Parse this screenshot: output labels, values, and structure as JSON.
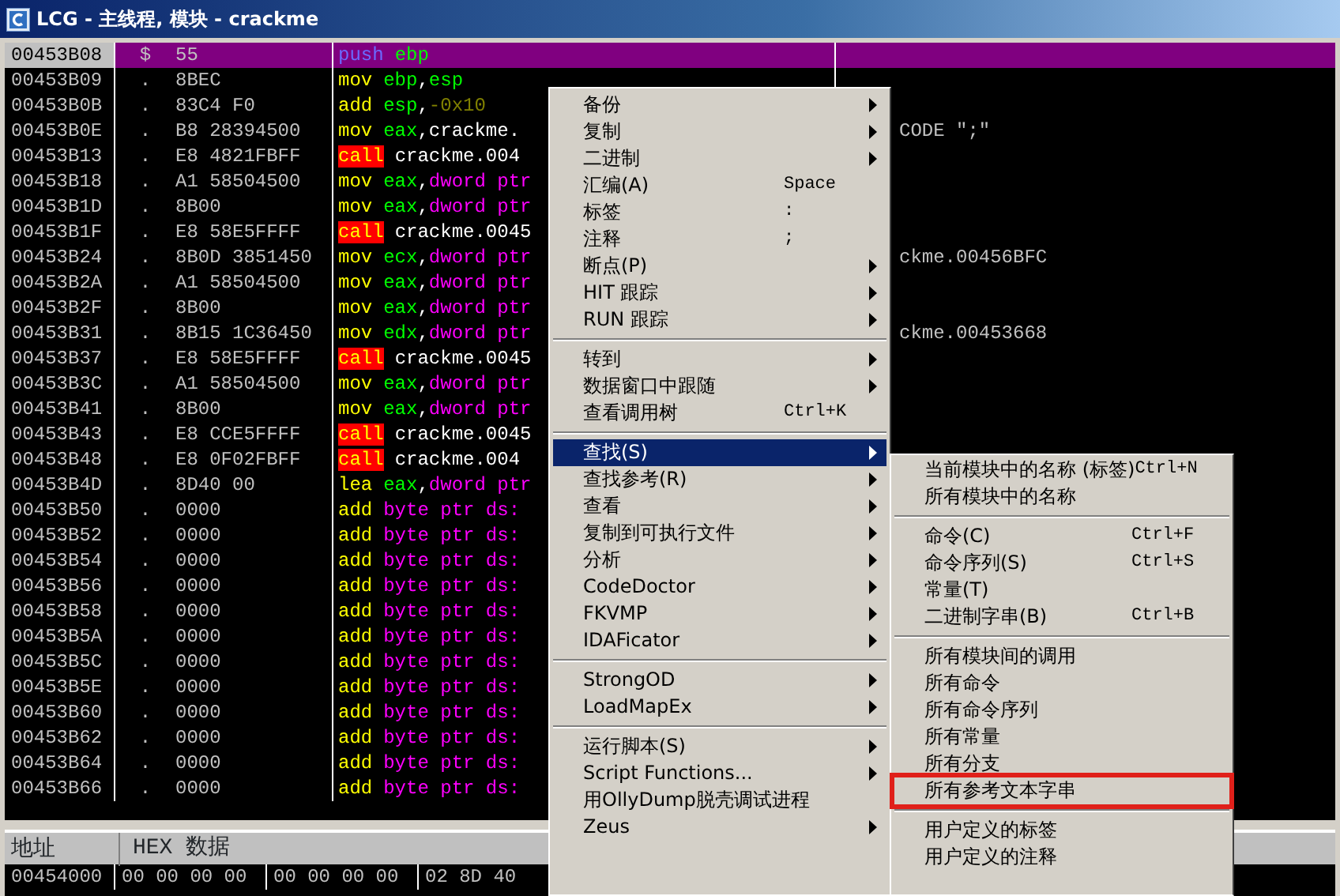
{
  "window": {
    "title": "LCG -  主线程, 模块 - crackme"
  },
  "disassembly": {
    "rows": [
      {
        "address": "00453B08",
        "mark": "$",
        "hex": "55",
        "selected": true,
        "asm": [
          {
            "text": "push",
            "kind": "push"
          },
          {
            "text": "ebp",
            "kind": "reg"
          }
        ]
      },
      {
        "address": "00453B09",
        "mark": ".",
        "hex": "8BEC",
        "selected": false,
        "asm": [
          {
            "text": "mov",
            "kind": "mn"
          },
          {
            "text": "ebp",
            "kind": "reg"
          },
          {
            "text": ",",
            "kind": "punct"
          },
          {
            "text": "esp",
            "kind": "reg"
          }
        ]
      },
      {
        "address": "00453B0B",
        "mark": ".",
        "hex": "83C4 F0",
        "selected": false,
        "asm": [
          {
            "text": "add",
            "kind": "mn"
          },
          {
            "text": "esp",
            "kind": "reg"
          },
          {
            "text": ",",
            "kind": "punct"
          },
          {
            "text": "-0x10",
            "kind": "imm"
          }
        ]
      },
      {
        "address": "00453B0E",
        "mark": ".",
        "hex": "B8 28394500",
        "selected": false,
        "asm": [
          {
            "text": "mov",
            "kind": "mn"
          },
          {
            "text": "eax",
            "kind": "reg"
          },
          {
            "text": ",",
            "kind": "punct"
          },
          {
            "text": "crackme.",
            "kind": "sym"
          }
        ],
        "comment": "CODE \";\""
      },
      {
        "address": "00453B13",
        "mark": ".",
        "hex": "E8 4821FBFF",
        "selected": false,
        "asm": [
          {
            "text": "call",
            "kind": "call"
          },
          {
            "text": "crackme.004",
            "kind": "sym"
          }
        ]
      },
      {
        "address": "00453B18",
        "mark": ".",
        "hex": "A1 58504500",
        "selected": false,
        "asm": [
          {
            "text": "mov",
            "kind": "mn"
          },
          {
            "text": "eax",
            "kind": "reg"
          },
          {
            "text": ",",
            "kind": "punct"
          },
          {
            "text": "dword ptr",
            "kind": "mem"
          }
        ]
      },
      {
        "address": "00453B1D",
        "mark": ".",
        "hex": "8B00",
        "selected": false,
        "asm": [
          {
            "text": "mov",
            "kind": "mn"
          },
          {
            "text": "eax",
            "kind": "reg"
          },
          {
            "text": ",",
            "kind": "punct"
          },
          {
            "text": "dword ptr",
            "kind": "mem"
          }
        ]
      },
      {
        "address": "00453B1F",
        "mark": ".",
        "hex": "E8 58E5FFFF",
        "selected": false,
        "asm": [
          {
            "text": "call",
            "kind": "call"
          },
          {
            "text": "crackme.0045",
            "kind": "sym"
          }
        ]
      },
      {
        "address": "00453B24",
        "mark": ".",
        "hex": "8B0D 3851450",
        "selected": false,
        "asm": [
          {
            "text": "mov",
            "kind": "mn"
          },
          {
            "text": "ecx",
            "kind": "reg"
          },
          {
            "text": ",",
            "kind": "punct"
          },
          {
            "text": "dword ptr",
            "kind": "mem"
          }
        ],
        "comment": "ckme.00456BFC"
      },
      {
        "address": "00453B2A",
        "mark": ".",
        "hex": "A1 58504500",
        "selected": false,
        "asm": [
          {
            "text": "mov",
            "kind": "mn"
          },
          {
            "text": "eax",
            "kind": "reg"
          },
          {
            "text": ",",
            "kind": "punct"
          },
          {
            "text": "dword ptr",
            "kind": "mem"
          }
        ]
      },
      {
        "address": "00453B2F",
        "mark": ".",
        "hex": "8B00",
        "selected": false,
        "asm": [
          {
            "text": "mov",
            "kind": "mn"
          },
          {
            "text": "eax",
            "kind": "reg"
          },
          {
            "text": ",",
            "kind": "punct"
          },
          {
            "text": "dword ptr",
            "kind": "mem"
          }
        ]
      },
      {
        "address": "00453B31",
        "mark": ".",
        "hex": "8B15 1C36450",
        "selected": false,
        "asm": [
          {
            "text": "mov",
            "kind": "mn"
          },
          {
            "text": "edx",
            "kind": "reg"
          },
          {
            "text": ",",
            "kind": "punct"
          },
          {
            "text": "dword ptr",
            "kind": "mem"
          }
        ],
        "comment": "ckme.00453668"
      },
      {
        "address": "00453B37",
        "mark": ".",
        "hex": "E8 58E5FFFF",
        "selected": false,
        "asm": [
          {
            "text": "call",
            "kind": "call"
          },
          {
            "text": "crackme.0045",
            "kind": "sym"
          }
        ]
      },
      {
        "address": "00453B3C",
        "mark": ".",
        "hex": "A1 58504500",
        "selected": false,
        "asm": [
          {
            "text": "mov",
            "kind": "mn"
          },
          {
            "text": "eax",
            "kind": "reg"
          },
          {
            "text": ",",
            "kind": "punct"
          },
          {
            "text": "dword ptr",
            "kind": "mem"
          }
        ]
      },
      {
        "address": "00453B41",
        "mark": ".",
        "hex": "8B00",
        "selected": false,
        "asm": [
          {
            "text": "mov",
            "kind": "mn"
          },
          {
            "text": "eax",
            "kind": "reg"
          },
          {
            "text": ",",
            "kind": "punct"
          },
          {
            "text": "dword ptr",
            "kind": "mem"
          }
        ]
      },
      {
        "address": "00453B43",
        "mark": ".",
        "hex": "E8 CCE5FFFF",
        "selected": false,
        "asm": [
          {
            "text": "call",
            "kind": "call"
          },
          {
            "text": "crackme.0045",
            "kind": "sym"
          }
        ]
      },
      {
        "address": "00453B48",
        "mark": ".",
        "hex": "E8 0F02FBFF",
        "selected": false,
        "asm": [
          {
            "text": "call",
            "kind": "call"
          },
          {
            "text": "crackme.004",
            "kind": "sym"
          }
        ]
      },
      {
        "address": "00453B4D",
        "mark": ".",
        "hex": "8D40 00",
        "selected": false,
        "asm": [
          {
            "text": "lea",
            "kind": "mn"
          },
          {
            "text": "eax",
            "kind": "reg"
          },
          {
            "text": ",",
            "kind": "punct"
          },
          {
            "text": "dword ptr",
            "kind": "mem"
          }
        ]
      },
      {
        "address": "00453B50",
        "mark": ".",
        "hex": "0000",
        "selected": false,
        "asm": [
          {
            "text": "add",
            "kind": "mn"
          },
          {
            "text": "byte ptr ds:",
            "kind": "mem"
          }
        ]
      },
      {
        "address": "00453B52",
        "mark": ".",
        "hex": "0000",
        "selected": false,
        "asm": [
          {
            "text": "add",
            "kind": "mn"
          },
          {
            "text": "byte ptr ds:",
            "kind": "mem"
          }
        ]
      },
      {
        "address": "00453B54",
        "mark": ".",
        "hex": "0000",
        "selected": false,
        "asm": [
          {
            "text": "add",
            "kind": "mn"
          },
          {
            "text": "byte ptr ds:",
            "kind": "mem"
          }
        ]
      },
      {
        "address": "00453B56",
        "mark": ".",
        "hex": "0000",
        "selected": false,
        "asm": [
          {
            "text": "add",
            "kind": "mn"
          },
          {
            "text": "byte ptr ds:",
            "kind": "mem"
          }
        ]
      },
      {
        "address": "00453B58",
        "mark": ".",
        "hex": "0000",
        "selected": false,
        "asm": [
          {
            "text": "add",
            "kind": "mn"
          },
          {
            "text": "byte ptr ds:",
            "kind": "mem"
          }
        ]
      },
      {
        "address": "00453B5A",
        "mark": ".",
        "hex": "0000",
        "selected": false,
        "asm": [
          {
            "text": "add",
            "kind": "mn"
          },
          {
            "text": "byte ptr ds:",
            "kind": "mem"
          }
        ]
      },
      {
        "address": "00453B5C",
        "mark": ".",
        "hex": "0000",
        "selected": false,
        "asm": [
          {
            "text": "add",
            "kind": "mn"
          },
          {
            "text": "byte ptr ds:",
            "kind": "mem"
          }
        ]
      },
      {
        "address": "00453B5E",
        "mark": ".",
        "hex": "0000",
        "selected": false,
        "asm": [
          {
            "text": "add",
            "kind": "mn"
          },
          {
            "text": "byte ptr ds:",
            "kind": "mem"
          }
        ]
      },
      {
        "address": "00453B60",
        "mark": ".",
        "hex": "0000",
        "selected": false,
        "asm": [
          {
            "text": "add",
            "kind": "mn"
          },
          {
            "text": "byte ptr ds:",
            "kind": "mem"
          }
        ]
      },
      {
        "address": "00453B62",
        "mark": ".",
        "hex": "0000",
        "selected": false,
        "asm": [
          {
            "text": "add",
            "kind": "mn"
          },
          {
            "text": "byte ptr ds:",
            "kind": "mem"
          }
        ]
      },
      {
        "address": "00453B64",
        "mark": ".",
        "hex": "0000",
        "selected": false,
        "asm": [
          {
            "text": "add",
            "kind": "mn"
          },
          {
            "text": "byte ptr ds:",
            "kind": "mem"
          }
        ]
      },
      {
        "address": "00453B66",
        "mark": ".",
        "hex": "0000",
        "selected": false,
        "asm": [
          {
            "text": "add",
            "kind": "mn"
          },
          {
            "text": "byte ptr ds:",
            "kind": "mem"
          }
        ]
      }
    ]
  },
  "dump": {
    "columns": [
      "地址",
      "HEX 数据"
    ],
    "rows": [
      {
        "address": "00454000",
        "groups": [
          "00 00 00 00",
          "00 00 00 00",
          "02 8D 40"
        ]
      }
    ]
  },
  "context_menu": {
    "items": [
      {
        "kind": "item",
        "label": "备份",
        "submenu": true,
        "selected": false
      },
      {
        "kind": "item",
        "label": "复制",
        "submenu": true,
        "selected": false
      },
      {
        "kind": "item",
        "label": "二进制",
        "submenu": true,
        "selected": false
      },
      {
        "kind": "item",
        "label": "汇编(A)",
        "shortcut": "Space",
        "submenu": false,
        "selected": false
      },
      {
        "kind": "item",
        "label": "标签",
        "shortcut": ":",
        "submenu": false,
        "selected": false
      },
      {
        "kind": "item",
        "label": "注释",
        "shortcut": ";",
        "submenu": false,
        "selected": false
      },
      {
        "kind": "item",
        "label": "断点(P)",
        "submenu": true,
        "selected": false
      },
      {
        "kind": "item",
        "label": "HIT 跟踪",
        "submenu": true,
        "selected": false
      },
      {
        "kind": "item",
        "label": "RUN 跟踪",
        "submenu": true,
        "selected": false
      },
      {
        "kind": "separator"
      },
      {
        "kind": "item",
        "label": "转到",
        "submenu": true,
        "selected": false
      },
      {
        "kind": "item",
        "label": "数据窗口中跟随",
        "submenu": true,
        "selected": false
      },
      {
        "kind": "item",
        "label": "查看调用树",
        "shortcut": "Ctrl+K",
        "submenu": false,
        "selected": false
      },
      {
        "kind": "separator"
      },
      {
        "kind": "item",
        "label": "查找(S)",
        "submenu": true,
        "selected": true
      },
      {
        "kind": "item",
        "label": "查找参考(R)",
        "submenu": true,
        "selected": false
      },
      {
        "kind": "item",
        "label": "查看",
        "submenu": true,
        "selected": false
      },
      {
        "kind": "item",
        "label": "复制到可执行文件",
        "submenu": true,
        "selected": false
      },
      {
        "kind": "item",
        "label": "分析",
        "submenu": true,
        "selected": false
      },
      {
        "kind": "item",
        "label": "CodeDoctor",
        "submenu": true,
        "selected": false
      },
      {
        "kind": "item",
        "label": "FKVMP",
        "submenu": true,
        "selected": false
      },
      {
        "kind": "item",
        "label": "IDAFicator",
        "submenu": true,
        "selected": false
      },
      {
        "kind": "separator"
      },
      {
        "kind": "item",
        "label": "StrongOD",
        "submenu": true,
        "selected": false
      },
      {
        "kind": "item",
        "label": "LoadMapEx",
        "submenu": true,
        "selected": false
      },
      {
        "kind": "separator"
      },
      {
        "kind": "item",
        "label": "运行脚本(S)",
        "submenu": true,
        "selected": false
      },
      {
        "kind": "item",
        "label": "Script Functions...",
        "submenu": true,
        "selected": false
      },
      {
        "kind": "item",
        "label": "用OllyDump脱壳调试进程",
        "submenu": false,
        "selected": false
      },
      {
        "kind": "item",
        "label": "Zeus",
        "submenu": true,
        "selected": false
      }
    ]
  },
  "search_submenu": {
    "items": [
      {
        "kind": "item",
        "label": "当前模块中的名称 (标签)",
        "shortcut": "Ctrl+N",
        "boxed": false
      },
      {
        "kind": "item",
        "label": "所有模块中的名称",
        "boxed": false
      },
      {
        "kind": "separator"
      },
      {
        "kind": "item",
        "label": "命令(C)",
        "shortcut": "Ctrl+F",
        "boxed": false
      },
      {
        "kind": "item",
        "label": "命令序列(S)",
        "shortcut": "Ctrl+S",
        "boxed": false
      },
      {
        "kind": "item",
        "label": "常量(T)",
        "boxed": false
      },
      {
        "kind": "item",
        "label": "二进制字串(B)",
        "shortcut": "Ctrl+B",
        "boxed": false
      },
      {
        "kind": "separator"
      },
      {
        "kind": "item",
        "label": "所有模块间的调用",
        "boxed": false
      },
      {
        "kind": "item",
        "label": "所有命令",
        "boxed": false
      },
      {
        "kind": "item",
        "label": "所有命令序列",
        "boxed": false
      },
      {
        "kind": "item",
        "label": "所有常量",
        "boxed": false
      },
      {
        "kind": "item",
        "label": "所有分支",
        "boxed": false
      },
      {
        "kind": "item",
        "label": "所有参考文本字串",
        "boxed": true
      },
      {
        "kind": "separator"
      },
      {
        "kind": "item",
        "label": "用户定义的标签",
        "boxed": false
      },
      {
        "kind": "item",
        "label": "用户定义的注释",
        "boxed": false
      }
    ]
  }
}
